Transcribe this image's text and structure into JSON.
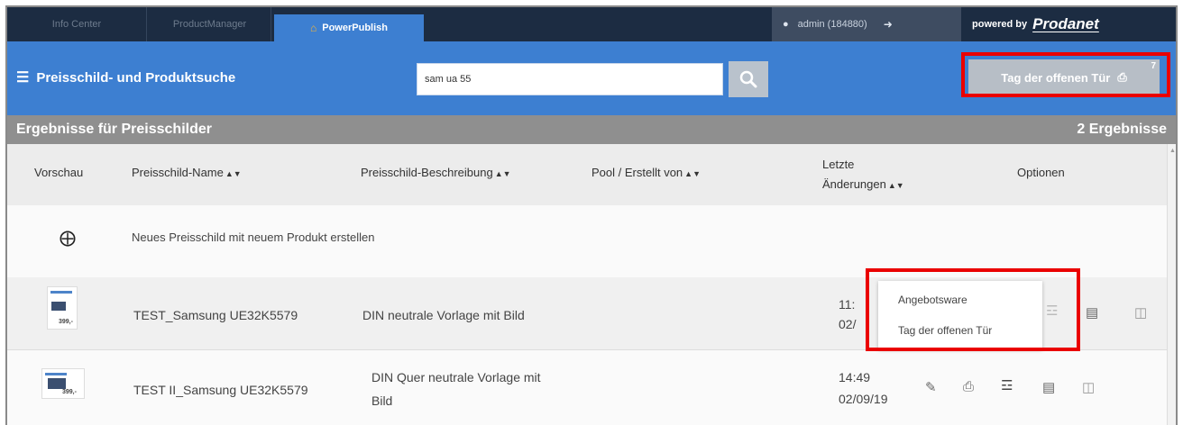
{
  "tabs": {
    "info_center": "Info Center",
    "product_manager": "ProductManager",
    "power_publish": "PowerPublish"
  },
  "user": {
    "label": "admin (184880)"
  },
  "powered": {
    "prefix": "powered by",
    "brand": "Prodanet"
  },
  "header": {
    "title": "Preisschild- und Produktsuche",
    "search_value": "sam ua 55",
    "tag_button": "Tag der offenen Tür",
    "tag_button_sup": "7"
  },
  "results": {
    "title": "Ergebnisse für Preisschilder",
    "count": "2 Ergebnisse"
  },
  "table": {
    "columns": {
      "preview": "Vorschau",
      "name": "Preisschild-Name",
      "description": "Preisschild-Beschreibung",
      "pool": "Pool / Erstellt von",
      "last_changed_1": "Letzte",
      "last_changed_2": "Änderungen",
      "options": "Optionen"
    },
    "new_row": "Neues Preisschild mit neuem Produkt erstellen",
    "rows": [
      {
        "name": "TEST_Samsung UE32K5579",
        "description": "DIN neutrale Vorlage mit Bild",
        "time": "11:",
        "date": "02/",
        "thumb_price": "399,-"
      },
      {
        "name": "TEST II_Samsung UE32K5579",
        "description_1": "DIN Quer neutrale Vorlage mit",
        "description_2": "Bild",
        "time": "14:49",
        "date": "02/09/19",
        "thumb_price": "399,-"
      }
    ]
  },
  "dropdown": {
    "items": [
      "Angebotsware",
      "Tag der offenen Tür"
    ]
  },
  "colors": {
    "topbar": "#1c2c42",
    "header": "#3d7fd1",
    "highlight": "#ea0000",
    "results_bar": "#8f8f8f"
  },
  "icons": {
    "menu": "menu-icon",
    "search": "search-icon",
    "print": "print-icon",
    "user": "user-icon",
    "logout": "logout-icon",
    "home": "home-icon",
    "add": "plus-circle-icon",
    "edit": "edit-icon",
    "export": "file-export-icon",
    "delete": "trash-icon",
    "batch_print": "batch-print-icon"
  }
}
